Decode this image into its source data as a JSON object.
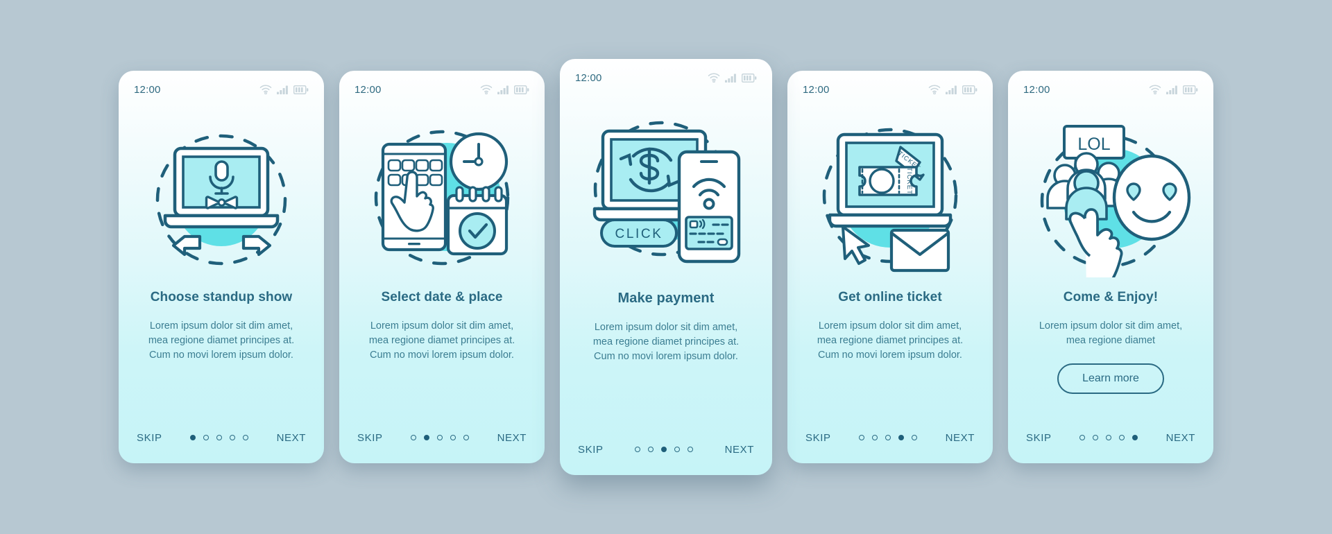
{
  "background_color": "#b7c8d2",
  "theme": {
    "accent": "#2a6a83",
    "teal": "#5fe0e6",
    "screen_fill": "#a9edf2",
    "text": "#3b7d91"
  },
  "status_bar": {
    "time": "12:00",
    "icons": [
      "wifi-icon",
      "signal-icon",
      "battery-icon"
    ]
  },
  "nav": {
    "skip_label": "SKIP",
    "next_label": "NEXT",
    "dot_count": 5
  },
  "screens": [
    {
      "id": "choose-standup-show",
      "title": "Choose standup show",
      "body": "Lorem ipsum dolor sit dim amet, mea regione diamet principes at. Cum no movi lorem ipsum dolor.",
      "illustration": "laptop-microphone-bowtie-arrows",
      "active_dot": 1,
      "featured": false,
      "cta": null
    },
    {
      "id": "select-date-place",
      "title": "Select date & place",
      "body": "Lorem ipsum dolor sit dim amet, mea regione diamet principes at. Cum no movi lorem ipsum dolor.",
      "illustration": "phone-grid-hand-clock-calendar",
      "active_dot": 2,
      "featured": false,
      "cta": null
    },
    {
      "id": "make-payment",
      "title": "Make payment",
      "body": "Lorem ipsum dolor sit dim amet, mea regione diamet principes at. Cum no movi lorem ipsum dolor.",
      "illustration": "laptop-dollar-phone-card-click",
      "click_badge": "CLICK",
      "active_dot": 3,
      "featured": true,
      "cta": null
    },
    {
      "id": "get-online-ticket",
      "title": "Get online ticket",
      "body": "Lorem ipsum dolor sit dim amet, mea regione diamet principes at. Cum no movi lorem ipsum dolor.",
      "illustration": "laptop-tickets-cursor-envelope",
      "ticket_label": "TICKET",
      "active_dot": 4,
      "featured": false,
      "cta": null
    },
    {
      "id": "come-and-enjoy",
      "title": "Come & Enjoy!",
      "body": "Lorem ipsum dolor sit dim amet, mea regione diamet",
      "illustration": "people-smiley-thumbsup-lol",
      "speech_bubble": "LOL",
      "active_dot": 5,
      "featured": false,
      "cta": "Learn more"
    }
  ]
}
